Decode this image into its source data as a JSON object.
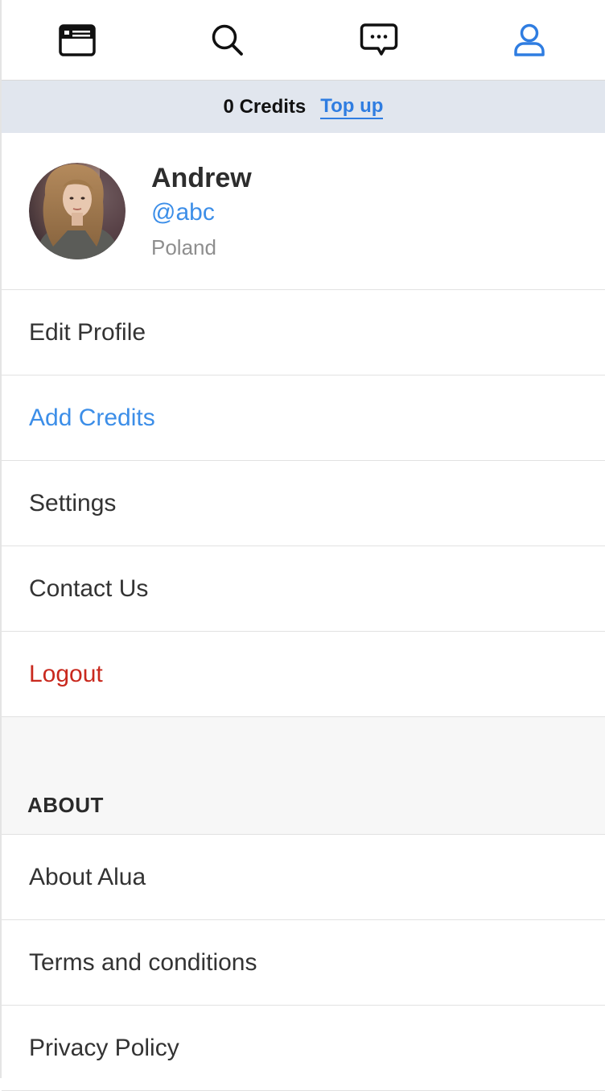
{
  "nav": {
    "items": [
      {
        "icon": "browser-window-icon",
        "active": false
      },
      {
        "icon": "search-icon",
        "active": false
      },
      {
        "icon": "chat-bubble-icon",
        "active": false
      },
      {
        "icon": "user-icon",
        "active": true
      }
    ],
    "active_color": "#2f7de1",
    "inactive_color": "#111111"
  },
  "credits": {
    "count_label": "0 Credits",
    "topup_label": "Top up"
  },
  "profile": {
    "name": "Andrew",
    "handle": "@abc",
    "country": "Poland"
  },
  "menu": {
    "edit_profile": "Edit Profile",
    "add_credits": "Add Credits",
    "settings": "Settings",
    "contact_us": "Contact Us",
    "logout": "Logout"
  },
  "about": {
    "header": "ABOUT",
    "about_alua": "About Alua",
    "terms": "Terms and conditions",
    "privacy": "Privacy Policy"
  },
  "colors": {
    "accent": "#3c8ee8",
    "danger": "#c9291e",
    "credits_bar_bg": "#e1e6ee"
  }
}
